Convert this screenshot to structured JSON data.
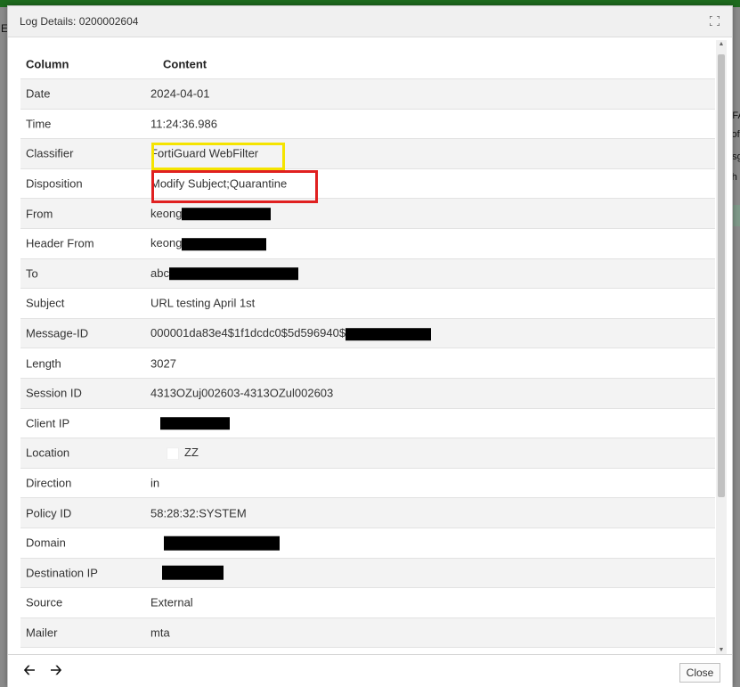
{
  "dialog": {
    "title": "Log Details: 0200002604",
    "close_label": "Close"
  },
  "table": {
    "headers": {
      "column": "Column",
      "content": "Content"
    },
    "rows": [
      {
        "label": "Date",
        "value": "2024-04-01"
      },
      {
        "label": "Time",
        "value": "11:24:36.986"
      },
      {
        "label": "Classifier",
        "value": "FortiGuard WebFilter"
      },
      {
        "label": "Disposition",
        "value": "Modify Subject;Quarantine"
      },
      {
        "label": "From",
        "value": "keong"
      },
      {
        "label": "Header From",
        "value": "keong"
      },
      {
        "label": "To",
        "value": "abc"
      },
      {
        "label": "Subject",
        "value": "URL testing April 1st"
      },
      {
        "label": "Message-ID",
        "value": "000001da83e4$1f1dcdc0$5d596940$"
      },
      {
        "label": "Length",
        "value": "3027"
      },
      {
        "label": "Session ID",
        "value": "4313OZuj002603-4313OZul002603"
      },
      {
        "label": "Client IP",
        "value": ""
      },
      {
        "label": "Location",
        "value": "ZZ"
      },
      {
        "label": "Direction",
        "value": "in"
      },
      {
        "label": "Policy ID",
        "value": "58:28:32:SYSTEM"
      },
      {
        "label": "Domain",
        "value": ""
      },
      {
        "label": "Destination IP",
        "value": ""
      },
      {
        "label": "Source",
        "value": "External"
      },
      {
        "label": "Mailer",
        "value": "mta"
      }
    ]
  },
  "background": {
    "fragments": [
      "E",
      "=FA",
      "kof",
      "nsg",
      "): h"
    ]
  },
  "colors": {
    "highlight_yellow": "#f5e400",
    "highlight_red": "#e02020",
    "topbar": "#1e6b1e"
  },
  "icons": {
    "prev": "arrow-left-icon",
    "next": "arrow-right-icon",
    "maximize": "maximize-icon"
  }
}
